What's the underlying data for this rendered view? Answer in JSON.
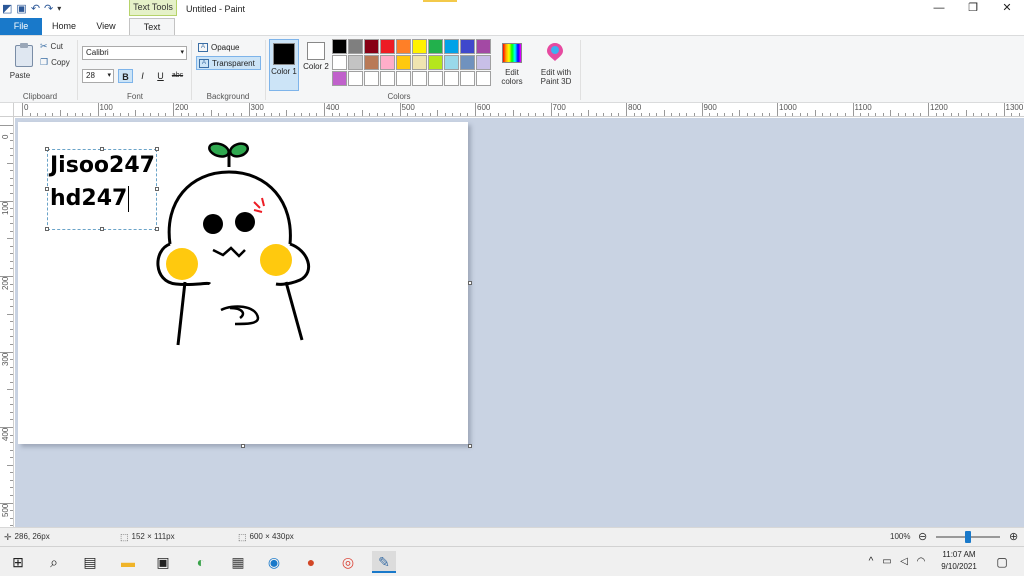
{
  "window": {
    "title": "Untitled - Paint",
    "context_tab": "Text Tools",
    "controls": {
      "minimize": "—",
      "maximize": "❐",
      "close": "✕"
    }
  },
  "tabs": [
    {
      "label": "File"
    },
    {
      "label": "Home"
    },
    {
      "label": "View"
    },
    {
      "label": "Text"
    }
  ],
  "ribbon": {
    "clipboard": {
      "label": "Clipboard",
      "paste": "Paste",
      "cut": "Cut",
      "copy": "Copy"
    },
    "font": {
      "label": "Font",
      "family": "Calibri",
      "size": "28",
      "bold": "B",
      "italic": "I",
      "underline": "U",
      "strikethrough": "abc"
    },
    "background": {
      "label": "Background",
      "opaque": "Opaque",
      "transparent": "Transparent"
    },
    "colors": {
      "label": "Colors",
      "color1_label": "Color 1",
      "color1_value": "#000000",
      "color2_label": "Color 2",
      "color2_value": "#ffffff",
      "edit_colors": "Edit colors",
      "edit_with_paint3d": "Edit with Paint 3D",
      "palette": [
        "#000000",
        "#7f7f7f",
        "#880015",
        "#ed1c24",
        "#ff7f27",
        "#fff200",
        "#22b14c",
        "#00a2e8",
        "#3f48cc",
        "#a349a4",
        "#ffffff",
        "#c3c3c3",
        "#b97a57",
        "#ffaec9",
        "#ffc90e",
        "#efe4b0",
        "#b5e61d",
        "#99d9ea",
        "#7092be",
        "#c8bfe7",
        "#c061cb",
        "#ffffff",
        "#ffffff",
        "#ffffff",
        "#ffffff",
        "#ffffff",
        "#ffffff",
        "#ffffff",
        "#ffffff",
        "#ffffff"
      ]
    }
  },
  "ruler": {
    "top_labels": [
      "0",
      "100",
      "200",
      "300",
      "400",
      "500",
      "600",
      "700",
      "800",
      "900",
      "1000",
      "1100",
      "1200",
      "1300"
    ],
    "left_labels": [
      "0",
      "100",
      "200",
      "300",
      "400",
      "500"
    ]
  },
  "canvas": {
    "text_lines": [
      "Jisoo247",
      "hd247"
    ]
  },
  "status": {
    "cursor_pos": "286, 26px",
    "selection_size": "152 × 111px",
    "image_size": "600 × 430px",
    "zoom": "100%",
    "zoom_out": "⊖",
    "zoom_in": "⊕"
  },
  "taskbar": {
    "time": "11:07 AM",
    "date": "9/10/2021",
    "tray_chevron": "^"
  }
}
